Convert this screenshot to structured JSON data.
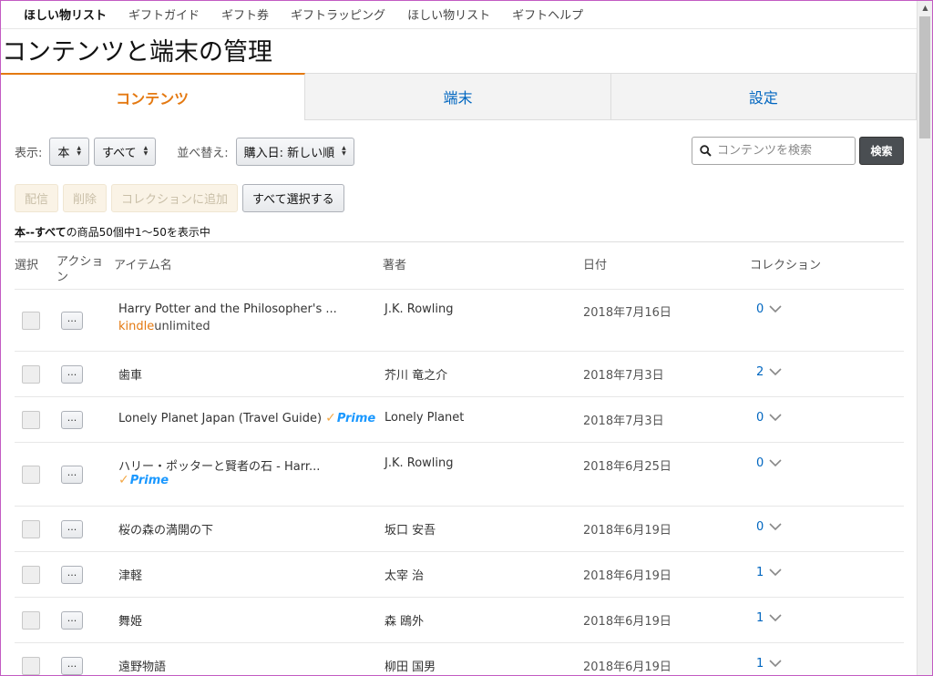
{
  "topnav": {
    "items": [
      "ほしい物リスト",
      "ギフトガイド",
      "ギフト券",
      "ギフトラッピング",
      "ほしい物リスト",
      "ギフトヘルプ"
    ]
  },
  "page": {
    "title": "コンテンツと端末の管理"
  },
  "tabs": [
    {
      "label": "コンテンツ",
      "active": true
    },
    {
      "label": "端末",
      "active": false
    },
    {
      "label": "設定",
      "active": false
    }
  ],
  "filters": {
    "show_label": "表示:",
    "type_value": "本",
    "scope_value": "すべて",
    "sort_label": "並べ替え:",
    "sort_value": "購入日: 新しい順"
  },
  "search": {
    "placeholder": "コンテンツを検索",
    "button": "検索"
  },
  "actions": {
    "deliver": "配信",
    "delete": "削除",
    "add_collection": "コレクションに追加",
    "select_all": "すべて選択する"
  },
  "summary": {
    "prefix": "本--すべて",
    "text": "の商品50個中1～50を表示中"
  },
  "table": {
    "headers": {
      "select": "選択",
      "action_1": "アクショ",
      "action_2": "ン",
      "item": "アイテム名",
      "author": "著者",
      "date": "日付",
      "collection": "コレクション"
    },
    "action_label": "...",
    "rows": [
      {
        "title": "Harry Potter and the Philosopher's ...",
        "author": "J.K. Rowling",
        "date": "2018年7月16日",
        "collections": "0",
        "badge": "kindleunlimited"
      },
      {
        "title": "歯車",
        "author": "芥川 竜之介",
        "date": "2018年7月3日",
        "collections": "2",
        "badge": ""
      },
      {
        "title": "Lonely Planet Japan (Travel Guide)",
        "author": "Lonely Planet",
        "date": "2018年7月3日",
        "collections": "0",
        "badge": "prime-inline"
      },
      {
        "title": "ハリー・ポッターと賢者の石 - Harr...",
        "author": "J.K. Rowling",
        "date": "2018年6月25日",
        "collections": "0",
        "badge": "prime"
      },
      {
        "title": "桜の森の満開の下",
        "author": "坂口 安吾",
        "date": "2018年6月19日",
        "collections": "0",
        "badge": ""
      },
      {
        "title": "津軽",
        "author": "太宰 治",
        "date": "2018年6月19日",
        "collections": "1",
        "badge": ""
      },
      {
        "title": "舞姫",
        "author": "森 鴎外",
        "date": "2018年6月19日",
        "collections": "1",
        "badge": ""
      },
      {
        "title": "遠野物語",
        "author": "柳田 国男",
        "date": "2018年6月19日",
        "collections": "1",
        "badge": ""
      }
    ]
  },
  "badges": {
    "kindle": "kindle",
    "unlimited": "unlimited",
    "prime": "Prime",
    "prime_check": "✓"
  },
  "colors": {
    "accent": "#e47911",
    "link": "#0066c0",
    "prime": "#1a98ff"
  }
}
